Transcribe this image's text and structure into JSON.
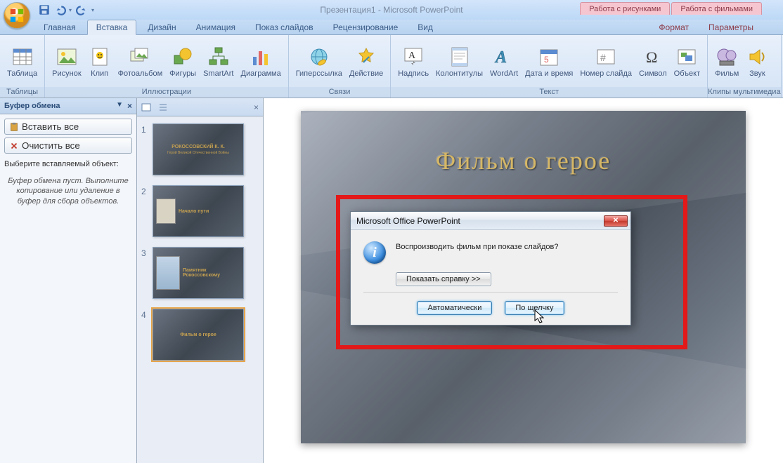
{
  "app": {
    "title": "Презентация1 - Microsoft PowerPoint"
  },
  "contextTabs": {
    "pictures": "Работа с рисунками",
    "movies": "Работа с фильмами",
    "format": "Формат",
    "params": "Параметры"
  },
  "tabs": {
    "home": "Главная",
    "insert": "Вставка",
    "design": "Дизайн",
    "animation": "Анимация",
    "slideshow": "Показ слайдов",
    "review": "Рецензирование",
    "view": "Вид"
  },
  "ribbon": {
    "tables": {
      "group": "Таблицы",
      "table": "Таблица"
    },
    "illustrations": {
      "group": "Иллюстрации",
      "picture": "Рисунок",
      "clip": "Клип",
      "album": "Фотоальбом",
      "shapes": "Фигуры",
      "smartart": "SmartArt",
      "chart": "Диаграмма"
    },
    "links": {
      "group": "Связи",
      "hyperlink": "Гиперссылка",
      "action": "Действие"
    },
    "text": {
      "group": "Текст",
      "textbox": "Надпись",
      "headerfooter": "Колонтитулы",
      "wordart": "WordArt",
      "datetime": "Дата и время",
      "slidenum": "Номер слайда",
      "symbol": "Символ",
      "object": "Объект"
    },
    "media": {
      "group": "Клипы мультимедиа",
      "movie": "Фильм",
      "sound": "Звук"
    }
  },
  "clipboard": {
    "title": "Буфер обмена",
    "pasteAll": "Вставить все",
    "clearAll": "Очистить все",
    "selectLabel": "Выберите вставляемый объект:",
    "emptyMsg": "Буфер обмена пуст. Выполните копирование или удаление в буфер для сбора объектов."
  },
  "thumbs": {
    "slide1": {
      "title": "РОКОССОВСКИЙ К. К.",
      "subtitle": "Герой Великой Отечественной Войны"
    },
    "slide2": {
      "title": "Начало пути"
    },
    "slide3": {
      "title": "Памятник Рокоссовскому"
    },
    "slide4": {
      "title": "Фильм о герое"
    }
  },
  "slide": {
    "title": "Фильм о герое"
  },
  "dialog": {
    "title": "Microsoft Office PowerPoint",
    "message": "Воспроизводить фильм при показе слайдов?",
    "helpBtn": "Показать справку >>",
    "autoBtn": "Автоматически",
    "clickBtn": "По щелчку",
    "info": "i"
  }
}
